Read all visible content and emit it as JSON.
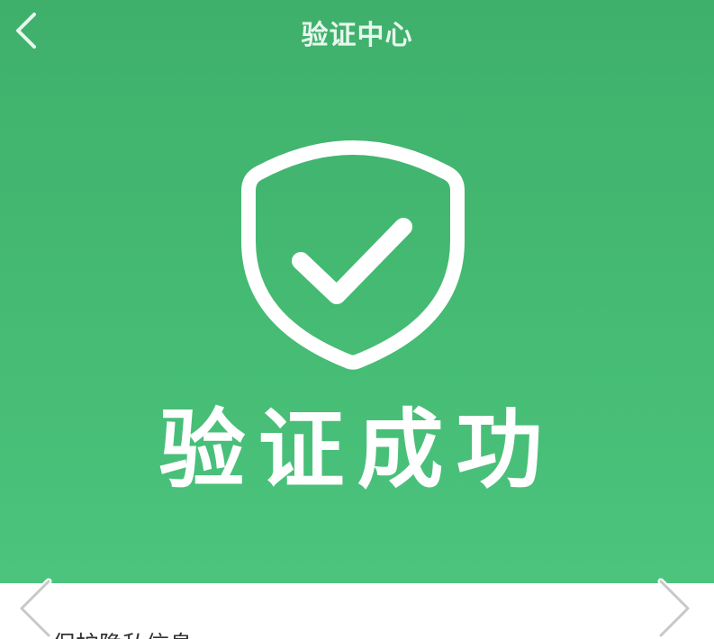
{
  "header": {
    "title": "验证中心",
    "back_icon": "chevron-left-icon"
  },
  "hero": {
    "icon": "shield-check-icon",
    "status_text": "验证成功",
    "background_color": "#45bb73"
  },
  "card": {
    "text": "保护隐私信息"
  },
  "carousel": {
    "prev_icon": "chevron-left-icon",
    "next_icon": "chevron-right-icon"
  }
}
